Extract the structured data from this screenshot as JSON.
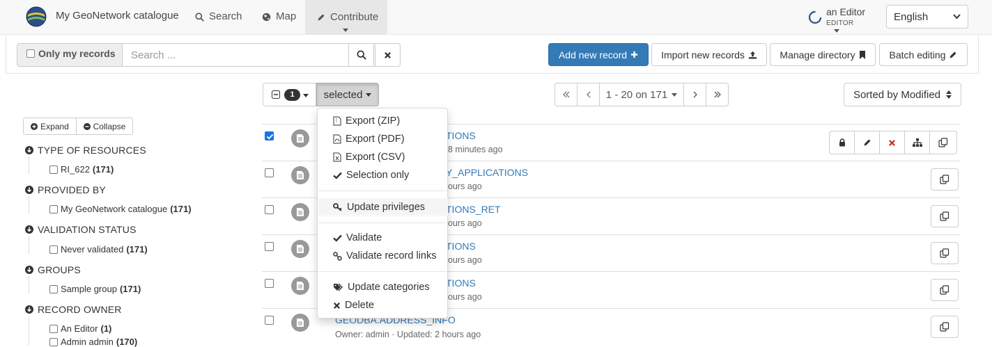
{
  "header": {
    "brand": "My GeoNetwork catalogue",
    "nav": [
      {
        "label": "Search",
        "icon": "search-icon"
      },
      {
        "label": "Map",
        "icon": "globe-icon"
      },
      {
        "label": "Contribute",
        "icon": "pencil-icon"
      }
    ],
    "user": {
      "name": "an Editor",
      "role": "EDITOR"
    },
    "language": "English"
  },
  "toolbar": {
    "only_mine_label": "Only my records",
    "search_placeholder": "Search ...",
    "add_new": "Add new record",
    "import": "Import new records",
    "manage_directory": "Manage directory",
    "batch_editing": "Batch editing"
  },
  "results_bar": {
    "selected_count": "1",
    "selected_label": "selected",
    "pagination": "1 - 20 on 171",
    "sort": "Sorted by Modified"
  },
  "facets": {
    "expand": "Expand",
    "collapse": "Collapse",
    "groups": [
      {
        "title": "TYPE OF RESOURCES",
        "items": [
          {
            "label": "RI_622",
            "count": "(171)"
          }
        ]
      },
      {
        "title": "PROVIDED BY",
        "items": [
          {
            "label": "My GeoNetwork catalogue",
            "count": "(171)"
          }
        ]
      },
      {
        "title": "VALIDATION STATUS",
        "items": [
          {
            "label": "Never validated",
            "count": "(171)"
          }
        ]
      },
      {
        "title": "GROUPS",
        "items": [
          {
            "label": "Sample group",
            "count": "(171)"
          }
        ]
      },
      {
        "title": "RECORD OWNER",
        "items": [
          {
            "label": "An Editor",
            "count": "(1)"
          },
          {
            "label": "Admin admin",
            "count": "(170)"
          }
        ]
      }
    ]
  },
  "results": [
    {
      "title": "TIONS",
      "meta": "8 minutes ago"
    },
    {
      "title": "Y_APPLICATIONS",
      "meta": "ours ago"
    },
    {
      "title": "TIONS_RET",
      "meta": "ours ago"
    },
    {
      "title": "TIONS",
      "meta": "ours ago"
    },
    {
      "title": "TIONS",
      "meta": "ours ago"
    },
    {
      "title": "GEODBA.ADDRESS_INFO",
      "meta": "Owner: admin · Updated: 2 hours ago"
    }
  ],
  "dropdown": {
    "items": [
      {
        "label": "Export (ZIP)",
        "icon": "file-zip-icon"
      },
      {
        "label": "Export (PDF)",
        "icon": "file-pdf-icon"
      },
      {
        "label": "Export (CSV)",
        "icon": "file-csv-icon"
      },
      {
        "label": "Selection only",
        "icon": "check-icon"
      },
      {
        "label": "Update privileges",
        "icon": "key-icon"
      },
      {
        "label": "Validate",
        "icon": "check-icon"
      },
      {
        "label": "Validate record links",
        "icon": "link-icon"
      },
      {
        "label": "Update categories",
        "icon": "tags-icon"
      },
      {
        "label": "Delete",
        "icon": "times-icon"
      }
    ]
  },
  "colors": {
    "primary": "#337ab7",
    "delete": "#c9302c",
    "navbar": "#f8f8f8"
  }
}
